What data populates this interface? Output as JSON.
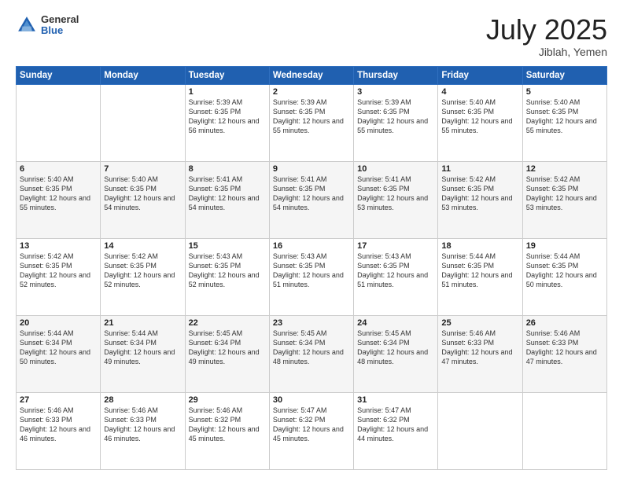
{
  "header": {
    "logo_general": "General",
    "logo_blue": "Blue",
    "month_title": "July 2025",
    "location": "Jiblah, Yemen"
  },
  "weekdays": [
    "Sunday",
    "Monday",
    "Tuesday",
    "Wednesday",
    "Thursday",
    "Friday",
    "Saturday"
  ],
  "weeks": [
    [
      {
        "day": "",
        "sunrise": "",
        "sunset": "",
        "daylight": ""
      },
      {
        "day": "",
        "sunrise": "",
        "sunset": "",
        "daylight": ""
      },
      {
        "day": "1",
        "sunrise": "Sunrise: 5:39 AM",
        "sunset": "Sunset: 6:35 PM",
        "daylight": "Daylight: 12 hours and 56 minutes."
      },
      {
        "day": "2",
        "sunrise": "Sunrise: 5:39 AM",
        "sunset": "Sunset: 6:35 PM",
        "daylight": "Daylight: 12 hours and 55 minutes."
      },
      {
        "day": "3",
        "sunrise": "Sunrise: 5:39 AM",
        "sunset": "Sunset: 6:35 PM",
        "daylight": "Daylight: 12 hours and 55 minutes."
      },
      {
        "day": "4",
        "sunrise": "Sunrise: 5:40 AM",
        "sunset": "Sunset: 6:35 PM",
        "daylight": "Daylight: 12 hours and 55 minutes."
      },
      {
        "day": "5",
        "sunrise": "Sunrise: 5:40 AM",
        "sunset": "Sunset: 6:35 PM",
        "daylight": "Daylight: 12 hours and 55 minutes."
      }
    ],
    [
      {
        "day": "6",
        "sunrise": "Sunrise: 5:40 AM",
        "sunset": "Sunset: 6:35 PM",
        "daylight": "Daylight: 12 hours and 55 minutes."
      },
      {
        "day": "7",
        "sunrise": "Sunrise: 5:40 AM",
        "sunset": "Sunset: 6:35 PM",
        "daylight": "Daylight: 12 hours and 54 minutes."
      },
      {
        "day": "8",
        "sunrise": "Sunrise: 5:41 AM",
        "sunset": "Sunset: 6:35 PM",
        "daylight": "Daylight: 12 hours and 54 minutes."
      },
      {
        "day": "9",
        "sunrise": "Sunrise: 5:41 AM",
        "sunset": "Sunset: 6:35 PM",
        "daylight": "Daylight: 12 hours and 54 minutes."
      },
      {
        "day": "10",
        "sunrise": "Sunrise: 5:41 AM",
        "sunset": "Sunset: 6:35 PM",
        "daylight": "Daylight: 12 hours and 53 minutes."
      },
      {
        "day": "11",
        "sunrise": "Sunrise: 5:42 AM",
        "sunset": "Sunset: 6:35 PM",
        "daylight": "Daylight: 12 hours and 53 minutes."
      },
      {
        "day": "12",
        "sunrise": "Sunrise: 5:42 AM",
        "sunset": "Sunset: 6:35 PM",
        "daylight": "Daylight: 12 hours and 53 minutes."
      }
    ],
    [
      {
        "day": "13",
        "sunrise": "Sunrise: 5:42 AM",
        "sunset": "Sunset: 6:35 PM",
        "daylight": "Daylight: 12 hours and 52 minutes."
      },
      {
        "day": "14",
        "sunrise": "Sunrise: 5:42 AM",
        "sunset": "Sunset: 6:35 PM",
        "daylight": "Daylight: 12 hours and 52 minutes."
      },
      {
        "day": "15",
        "sunrise": "Sunrise: 5:43 AM",
        "sunset": "Sunset: 6:35 PM",
        "daylight": "Daylight: 12 hours and 52 minutes."
      },
      {
        "day": "16",
        "sunrise": "Sunrise: 5:43 AM",
        "sunset": "Sunset: 6:35 PM",
        "daylight": "Daylight: 12 hours and 51 minutes."
      },
      {
        "day": "17",
        "sunrise": "Sunrise: 5:43 AM",
        "sunset": "Sunset: 6:35 PM",
        "daylight": "Daylight: 12 hours and 51 minutes."
      },
      {
        "day": "18",
        "sunrise": "Sunrise: 5:44 AM",
        "sunset": "Sunset: 6:35 PM",
        "daylight": "Daylight: 12 hours and 51 minutes."
      },
      {
        "day": "19",
        "sunrise": "Sunrise: 5:44 AM",
        "sunset": "Sunset: 6:35 PM",
        "daylight": "Daylight: 12 hours and 50 minutes."
      }
    ],
    [
      {
        "day": "20",
        "sunrise": "Sunrise: 5:44 AM",
        "sunset": "Sunset: 6:34 PM",
        "daylight": "Daylight: 12 hours and 50 minutes."
      },
      {
        "day": "21",
        "sunrise": "Sunrise: 5:44 AM",
        "sunset": "Sunset: 6:34 PM",
        "daylight": "Daylight: 12 hours and 49 minutes."
      },
      {
        "day": "22",
        "sunrise": "Sunrise: 5:45 AM",
        "sunset": "Sunset: 6:34 PM",
        "daylight": "Daylight: 12 hours and 49 minutes."
      },
      {
        "day": "23",
        "sunrise": "Sunrise: 5:45 AM",
        "sunset": "Sunset: 6:34 PM",
        "daylight": "Daylight: 12 hours and 48 minutes."
      },
      {
        "day": "24",
        "sunrise": "Sunrise: 5:45 AM",
        "sunset": "Sunset: 6:34 PM",
        "daylight": "Daylight: 12 hours and 48 minutes."
      },
      {
        "day": "25",
        "sunrise": "Sunrise: 5:46 AM",
        "sunset": "Sunset: 6:33 PM",
        "daylight": "Daylight: 12 hours and 47 minutes."
      },
      {
        "day": "26",
        "sunrise": "Sunrise: 5:46 AM",
        "sunset": "Sunset: 6:33 PM",
        "daylight": "Daylight: 12 hours and 47 minutes."
      }
    ],
    [
      {
        "day": "27",
        "sunrise": "Sunrise: 5:46 AM",
        "sunset": "Sunset: 6:33 PM",
        "daylight": "Daylight: 12 hours and 46 minutes."
      },
      {
        "day": "28",
        "sunrise": "Sunrise: 5:46 AM",
        "sunset": "Sunset: 6:33 PM",
        "daylight": "Daylight: 12 hours and 46 minutes."
      },
      {
        "day": "29",
        "sunrise": "Sunrise: 5:46 AM",
        "sunset": "Sunset: 6:32 PM",
        "daylight": "Daylight: 12 hours and 45 minutes."
      },
      {
        "day": "30",
        "sunrise": "Sunrise: 5:47 AM",
        "sunset": "Sunset: 6:32 PM",
        "daylight": "Daylight: 12 hours and 45 minutes."
      },
      {
        "day": "31",
        "sunrise": "Sunrise: 5:47 AM",
        "sunset": "Sunset: 6:32 PM",
        "daylight": "Daylight: 12 hours and 44 minutes."
      },
      {
        "day": "",
        "sunrise": "",
        "sunset": "",
        "daylight": ""
      },
      {
        "day": "",
        "sunrise": "",
        "sunset": "",
        "daylight": ""
      }
    ]
  ]
}
